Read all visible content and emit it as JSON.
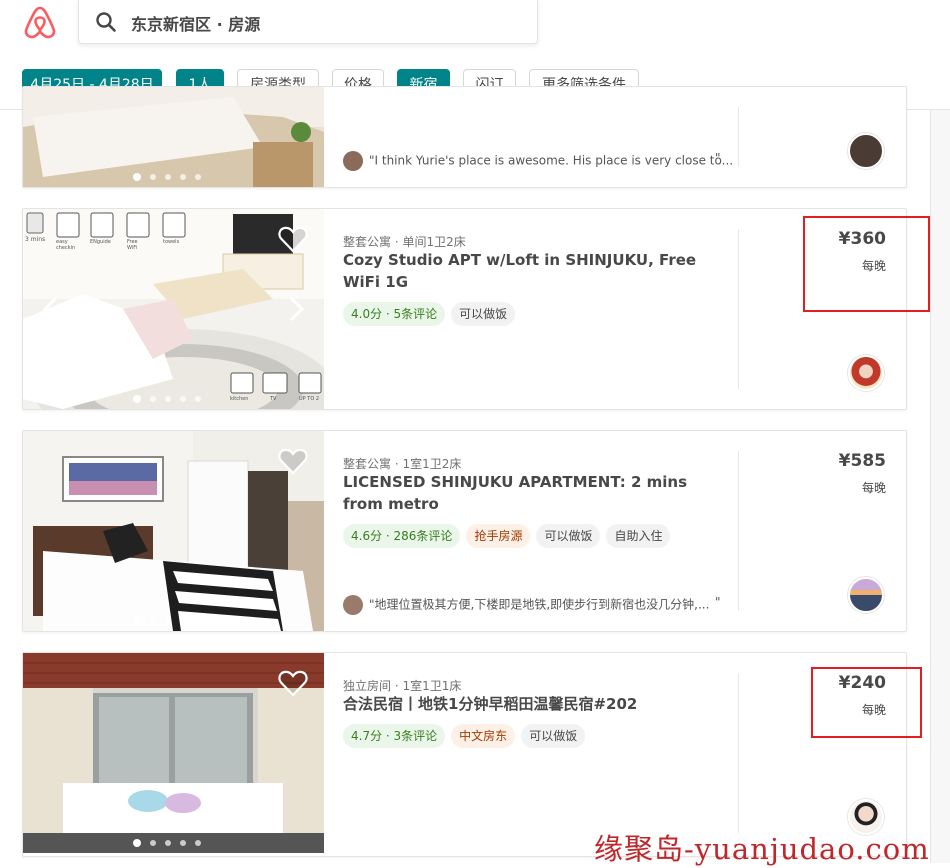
{
  "search": {
    "text": "东京新宿区 · 房源"
  },
  "filters": [
    {
      "label": "4月25日 - 4月28日",
      "active": true
    },
    {
      "label": "1人",
      "active": true
    },
    {
      "label": "房源类型",
      "active": false
    },
    {
      "label": "价格",
      "active": false
    },
    {
      "label": "新宿",
      "active": true
    },
    {
      "label": "闪订",
      "active": false
    },
    {
      "label": "更多筛选条件",
      "active": false
    }
  ],
  "listings": [
    {
      "review": "\"I think Yurie's place is awesome. His place is very close to...",
      "quote_end": "\""
    },
    {
      "meta": "整套公寓 · 单间1卫2床",
      "title": "Cozy Studio APT w/Loft in SHINJUKU, Free WiFi 1G",
      "tags": [
        "4.0分 · 5条评论",
        "可以做饭"
      ],
      "price": "¥360",
      "per_night": "每晚",
      "photo_icons": [
        "3 mins",
        "easy checkin",
        "ENguide",
        "Free WiFi",
        "towels",
        "kitchen",
        "TV",
        "UP TO 2"
      ]
    },
    {
      "meta": "整套公寓 · 1室1卫2床",
      "title": "LICENSED SHINJUKU APARTMENT: 2 mins from metro",
      "tags": [
        "4.6分 · 286条评论",
        "抢手房源",
        "可以做饭",
        "自助入住"
      ],
      "price": "¥585",
      "per_night": "每晚",
      "review": "\"地理位置极其方便,下楼即是地铁,即使步行到新宿也没几分钟,...",
      "quote_end": "\""
    },
    {
      "meta": "独立房间 · 1室1卫1床",
      "title": "合法民宿丨地铁1分钟早稻田温馨民宿#202",
      "tags": [
        "4.7分 · 3条评论",
        "中文房东",
        "可以做饭"
      ],
      "price": "¥240",
      "per_night": "每晚"
    }
  ],
  "watermark": "缘聚岛-yuanjudao.com",
  "colors": {
    "accent": "#008489",
    "brand": "#FF5A5F",
    "highlight": "#e02020"
  }
}
